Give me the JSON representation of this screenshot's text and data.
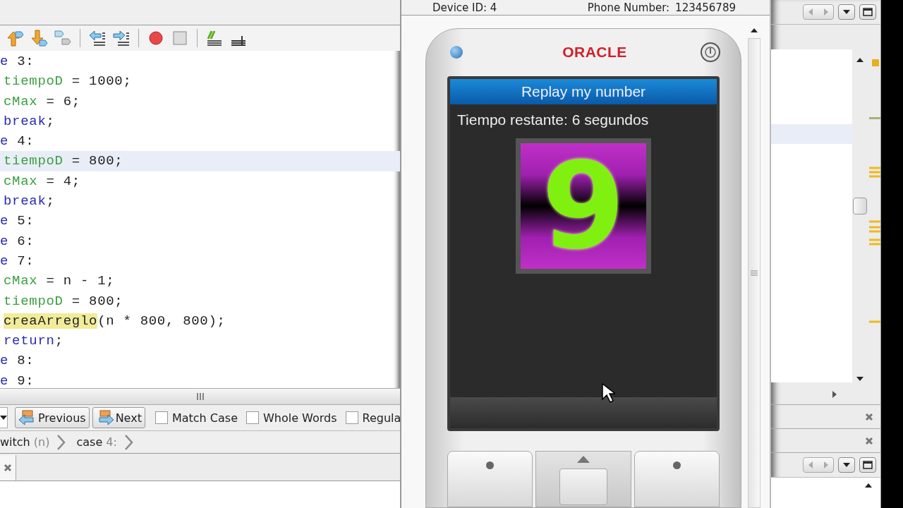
{
  "editor": {
    "lines": [
      {
        "current": false,
        "indented": false,
        "tokens": [
          {
            "text": "e",
            "kind": "keyword"
          },
          {
            "text": " 3:",
            "kind": "plain"
          }
        ]
      },
      {
        "current": false,
        "indented": true,
        "tokens": [
          {
            "text": "tiempoD",
            "kind": "field"
          },
          {
            "text": " = 1000;",
            "kind": "plain"
          }
        ]
      },
      {
        "current": false,
        "indented": true,
        "tokens": [
          {
            "text": "cMax",
            "kind": "field"
          },
          {
            "text": " = 6;",
            "kind": "plain"
          }
        ]
      },
      {
        "current": false,
        "indented": true,
        "tokens": [
          {
            "text": "break",
            "kind": "keyword"
          },
          {
            "text": ";",
            "kind": "plain"
          }
        ]
      },
      {
        "current": false,
        "indented": false,
        "tokens": [
          {
            "text": "e",
            "kind": "keyword"
          },
          {
            "text": " 4:",
            "kind": "plain"
          }
        ]
      },
      {
        "current": true,
        "indented": true,
        "tokens": [
          {
            "text": "tiempoD",
            "kind": "field"
          },
          {
            "text": " = 800;",
            "kind": "plain"
          }
        ]
      },
      {
        "current": false,
        "indented": true,
        "tokens": [
          {
            "text": "cMax",
            "kind": "field"
          },
          {
            "text": " = 4;",
            "kind": "plain"
          }
        ]
      },
      {
        "current": false,
        "indented": true,
        "tokens": [
          {
            "text": "break",
            "kind": "keyword"
          },
          {
            "text": ";",
            "kind": "plain"
          }
        ]
      },
      {
        "current": false,
        "indented": false,
        "tokens": [
          {
            "text": "e",
            "kind": "keyword"
          },
          {
            "text": " 5:",
            "kind": "plain"
          }
        ]
      },
      {
        "current": false,
        "indented": false,
        "tokens": [
          {
            "text": "e",
            "kind": "keyword"
          },
          {
            "text": " 6:",
            "kind": "plain"
          }
        ]
      },
      {
        "current": false,
        "indented": false,
        "tokens": [
          {
            "text": "e",
            "kind": "keyword"
          },
          {
            "text": " 7:",
            "kind": "plain"
          }
        ]
      },
      {
        "current": false,
        "indented": true,
        "tokens": [
          {
            "text": "cMax",
            "kind": "field"
          },
          {
            "text": " = n - 1;",
            "kind": "plain"
          }
        ]
      },
      {
        "current": false,
        "indented": true,
        "tokens": [
          {
            "text": "tiempoD",
            "kind": "field"
          },
          {
            "text": " = 800;",
            "kind": "plain"
          }
        ]
      },
      {
        "current": false,
        "indented": true,
        "tokens": [
          {
            "text": "creaArreglo",
            "kind": "highlight"
          },
          {
            "text": "(n * 800, 800);",
            "kind": "plain"
          }
        ]
      },
      {
        "current": false,
        "indented": true,
        "tokens": [
          {
            "text": "return",
            "kind": "keyword"
          },
          {
            "text": ";",
            "kind": "plain"
          }
        ]
      },
      {
        "current": false,
        "indented": false,
        "tokens": [
          {
            "text": "e",
            "kind": "keyword"
          },
          {
            "text": " 8:",
            "kind": "plain"
          }
        ]
      },
      {
        "current": false,
        "indented": false,
        "tokens": [
          {
            "text": "e",
            "kind": "keyword"
          },
          {
            "text": " 9:",
            "kind": "plain"
          }
        ]
      }
    ]
  },
  "search_bar": {
    "previous_button": "Previous",
    "next_button": "Next",
    "options": [
      {
        "label": "Match Case",
        "checked": false
      },
      {
        "label": "Whole Words",
        "checked": false
      },
      {
        "label": "Regula",
        "checked": false
      }
    ]
  },
  "breadcrumb": [
    {
      "name": "witch",
      "detail": "(n)"
    },
    {
      "name": "case",
      "detail": "4:"
    }
  ],
  "emulator": {
    "device_id": "Device ID: 4",
    "phone_number_label": "Phone Number:",
    "phone_number": "123456789",
    "brand": "ORACLE",
    "screen": {
      "title": "Replay my number",
      "status": "Tiempo restante: 6 segundos",
      "digit": "9"
    }
  }
}
